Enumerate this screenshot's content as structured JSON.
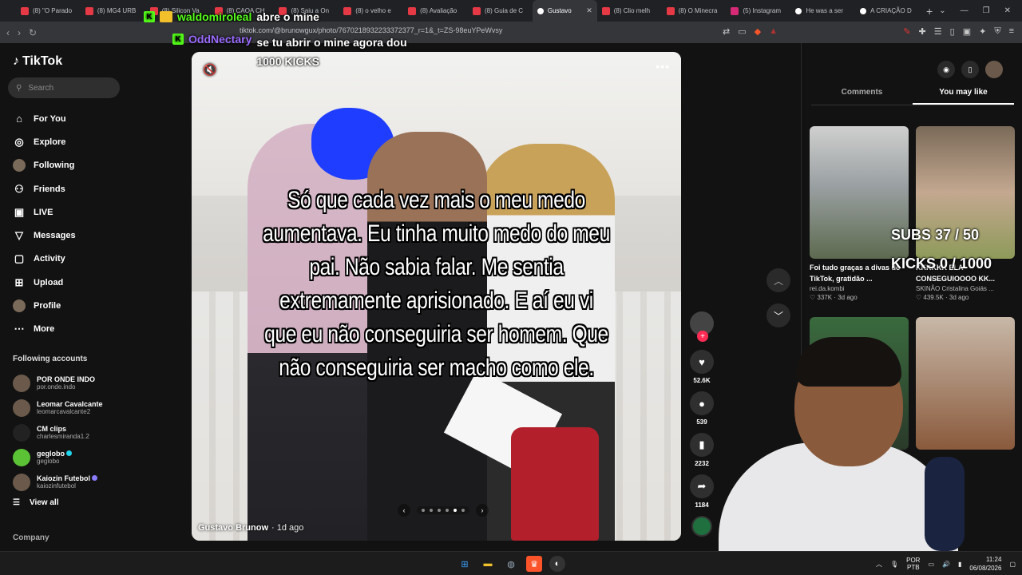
{
  "browser": {
    "tabs": [
      {
        "label": "(8) \"O Parado",
        "type": "yt"
      },
      {
        "label": "(8) MG4 URB",
        "type": "yt"
      },
      {
        "label": "(8) Silicon Va",
        "type": "yt"
      },
      {
        "label": "(8) CAOA CH",
        "type": "yt"
      },
      {
        "label": "(8) Saiu a On",
        "type": "yt"
      },
      {
        "label": "(8) o velho e",
        "type": "yt"
      },
      {
        "label": "(8) Avaliação",
        "type": "yt"
      },
      {
        "label": "(8) Guia de C",
        "type": "yt"
      },
      {
        "label": "Gustavo",
        "type": "tiktok",
        "active": true
      },
      {
        "label": "(8) Clio melh",
        "type": "yt"
      },
      {
        "label": "(8) O Minecra",
        "type": "yt"
      },
      {
        "label": "(5) Instagram",
        "type": "insta"
      },
      {
        "label": "He was a ser",
        "type": "tiktok"
      },
      {
        "label": "A CRIAÇÃO D",
        "type": "tiktok"
      }
    ],
    "url": "tiktok.com/@brunowgux/photo/7670218932233372377_r=1&_t=ZS-98euYPeWvsy"
  },
  "chat": [
    {
      "user": "waldomiroleal",
      "message": "abre o mine"
    },
    {
      "user": "OddNectary",
      "message": "se tu abrir o mine agora dou 1000 KICKS"
    }
  ],
  "tiktok": {
    "logo": "TikTok",
    "search_placeholder": "Search",
    "nav": [
      {
        "label": "For You",
        "icon": "home-icon"
      },
      {
        "label": "Explore",
        "icon": "compass-icon"
      },
      {
        "label": "Following",
        "icon": "avatar-icon"
      },
      {
        "label": "Friends",
        "icon": "friends-icon"
      },
      {
        "label": "LIVE",
        "icon": "live-icon"
      },
      {
        "label": "Messages",
        "icon": "messages-icon"
      },
      {
        "label": "Activity",
        "icon": "activity-icon"
      },
      {
        "label": "Upload",
        "icon": "upload-icon"
      },
      {
        "label": "Profile",
        "icon": "profile-icon"
      },
      {
        "label": "More",
        "icon": "more-icon"
      }
    ],
    "following_heading": "Following accounts",
    "accounts": [
      {
        "name": "POR ONDE INDO",
        "handle": "por.onde.indo",
        "verified": false
      },
      {
        "name": "Leomar Cavalcante",
        "handle": "leomarcavalcante2",
        "verified": false
      },
      {
        "name": "CM clips",
        "handle": "charlesmiranda1.2",
        "verified": false
      },
      {
        "name": "geglobo",
        "handle": "geglobo",
        "verified": true
      },
      {
        "name": "Kaiozin Futebol",
        "handle": "kaiozinfutebol",
        "verified": true
      }
    ],
    "view_all": "View all",
    "company": "Company"
  },
  "post": {
    "caption": "Só que cada vez mais o meu medo aumentava. Eu tinha muito medo do meu pai. Não sabia falar. Me sentia extremamente aprisionado. E aí eu vi que eu não conseguiria ser homem. Que não conseguiria ser macho como ele.",
    "author": "Gustavo Brunow",
    "time_ago": "1d ago",
    "slides_total": 6,
    "slide_current": 5,
    "likes": "52.6K",
    "comments": "539",
    "saves": "2232",
    "shares": "1184"
  },
  "right_panel": {
    "tabs": [
      "Comments",
      "You may like"
    ],
    "active_tab": "You may like",
    "cards": [
      {
        "title": "Foi tudo graças a divas do TikTok, gratidão ...",
        "author": "rei.da.kombi",
        "likes": "337K",
        "ago": "3d ago"
      },
      {
        "title": "KKKKKK ELA CONSEGUIOOOO KK...",
        "author": "SKINÃO Cristalina Goiás ...",
        "likes": "439.5K",
        "ago": "3d ago"
      }
    ]
  },
  "stream_overlay": {
    "subs": "SUBS 37 / 50",
    "kicks": "KICKS 0 / 1000"
  },
  "taskbar": {
    "lang_top": "POR",
    "lang_bottom": "PTB",
    "time": "11:24",
    "date": "06/08/2026"
  }
}
